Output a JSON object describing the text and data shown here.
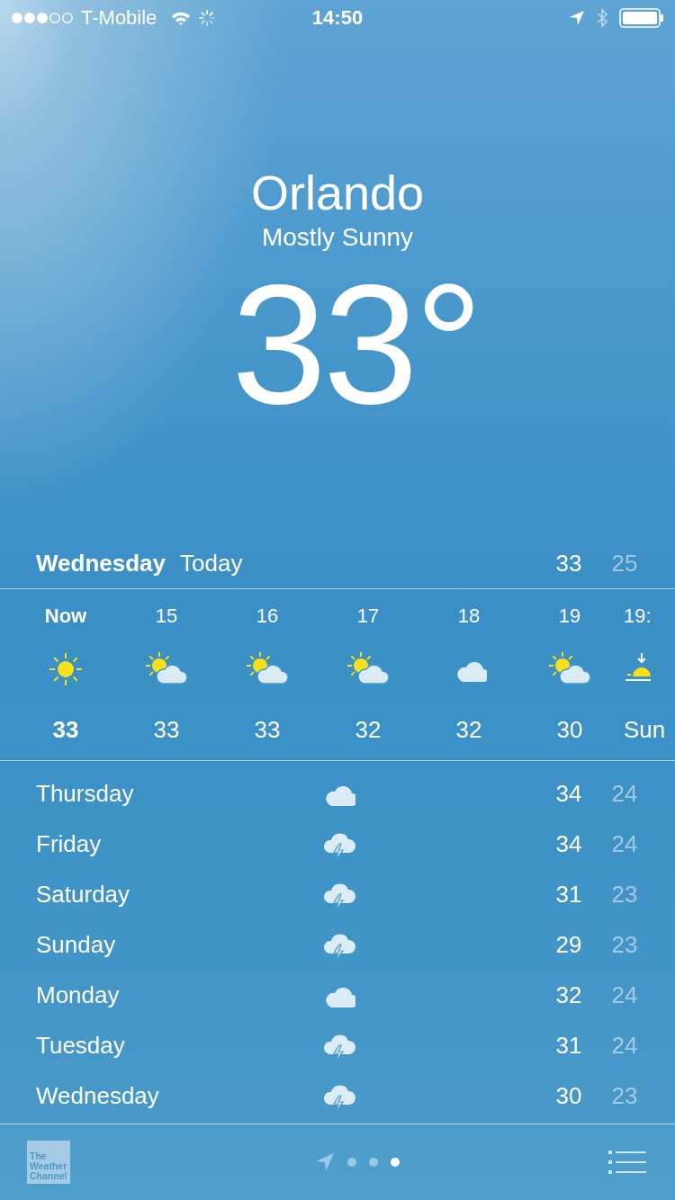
{
  "status_bar": {
    "carrier": "T-Mobile",
    "time": "14:50"
  },
  "location": {
    "city": "Orlando",
    "condition": "Mostly Sunny",
    "temperature": "33°"
  },
  "today": {
    "day": "Wednesday",
    "label": "Today",
    "high": "33",
    "low": "25"
  },
  "hourly": [
    {
      "time": "Now",
      "kind": "sun",
      "temp": "33",
      "now": true
    },
    {
      "time": "15",
      "kind": "partly",
      "temp": "33",
      "now": false
    },
    {
      "time": "16",
      "kind": "partly",
      "temp": "33",
      "now": false
    },
    {
      "time": "17",
      "kind": "partly",
      "temp": "32",
      "now": false
    },
    {
      "time": "18",
      "kind": "cloud",
      "temp": "32",
      "now": false
    },
    {
      "time": "19",
      "kind": "partly",
      "temp": "30",
      "now": false
    },
    {
      "time": "19:",
      "kind": "sunset",
      "temp": "Sun",
      "now": false
    }
  ],
  "daily": [
    {
      "day": "Thursday",
      "kind": "cloud",
      "high": "34",
      "low": "24"
    },
    {
      "day": "Friday",
      "kind": "storm",
      "high": "34",
      "low": "24"
    },
    {
      "day": "Saturday",
      "kind": "storm",
      "high": "31",
      "low": "23"
    },
    {
      "day": "Sunday",
      "kind": "storm",
      "high": "29",
      "low": "23"
    },
    {
      "day": "Monday",
      "kind": "cloud",
      "high": "32",
      "low": "24"
    },
    {
      "day": "Tuesday",
      "kind": "storm",
      "high": "31",
      "low": "24"
    },
    {
      "day": "Wednesday",
      "kind": "storm",
      "high": "30",
      "low": "23"
    }
  ],
  "bottom_bar": {
    "logo": "The Weather Channel",
    "pages": [
      {
        "kind": "location",
        "selected": false
      },
      {
        "kind": "dot",
        "selected": false
      },
      {
        "kind": "dot",
        "selected": false
      },
      {
        "kind": "dot",
        "selected": true
      }
    ]
  }
}
